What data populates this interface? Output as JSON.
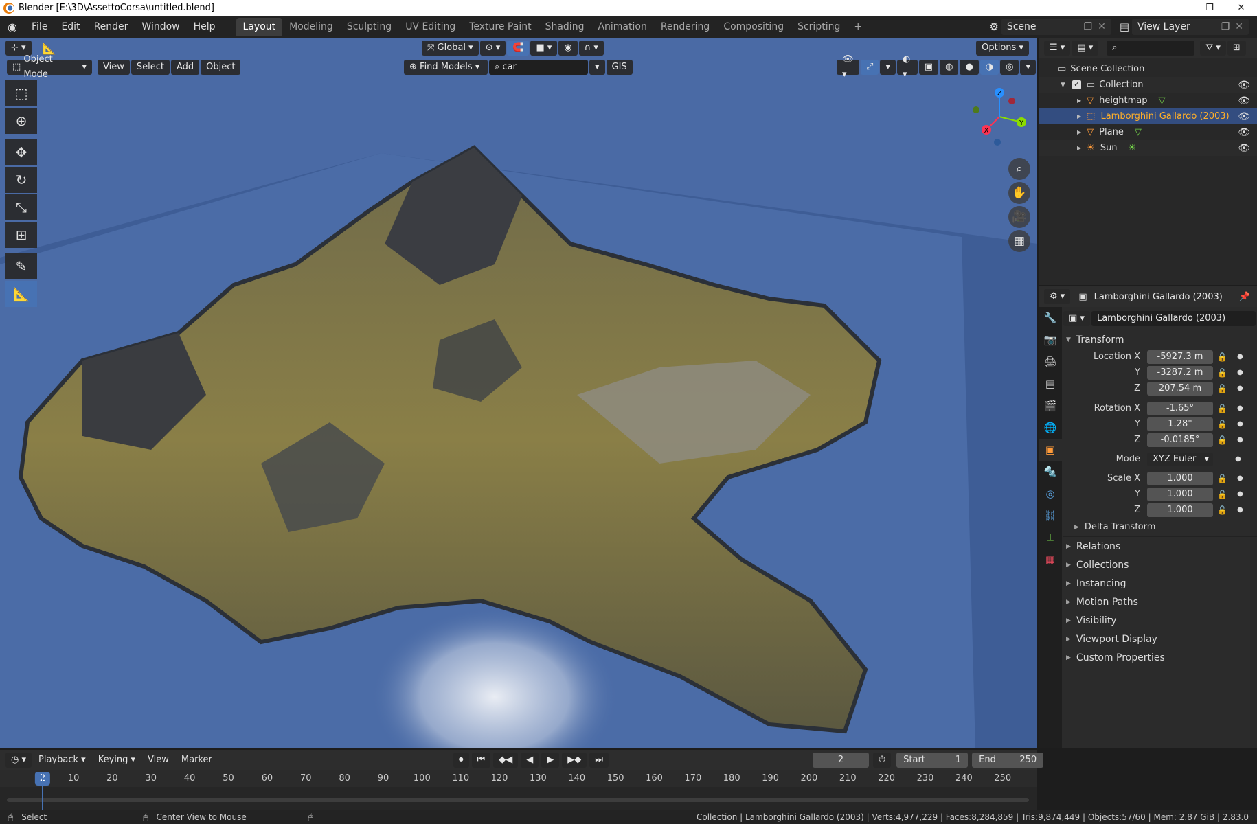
{
  "titlebar": {
    "title": "Blender [E:\\3D\\AssettoCorsa\\untitled.blend]",
    "minimize": "—",
    "restore": "❐",
    "close": "✕"
  },
  "menus": [
    "File",
    "Edit",
    "Render",
    "Window",
    "Help"
  ],
  "workspaces": [
    "Layout",
    "Modeling",
    "Sculpting",
    "UV Editing",
    "Texture Paint",
    "Shading",
    "Animation",
    "Rendering",
    "Compositing",
    "Scripting",
    "+"
  ],
  "scene": {
    "name": "Scene",
    "view_layer": "View Layer"
  },
  "viewport": {
    "orientation": "Global",
    "options": "Options",
    "mode": "Object Mode",
    "menus": [
      "View",
      "Select",
      "Add",
      "Object"
    ],
    "find_models": "Find Models",
    "search_value": "car",
    "gis": "GIS",
    "gizmo_axes": [
      "X",
      "Y",
      "Z"
    ]
  },
  "outliner": {
    "root": "Scene Collection",
    "collection": "Collection",
    "items": [
      {
        "label": "heightmap",
        "icon": "mesh-icon",
        "selected": false
      },
      {
        "label": "Lamborghini Gallardo (2003)",
        "icon": "empty-icon",
        "selected": true
      },
      {
        "label": "Plane",
        "icon": "mesh-icon",
        "selected": false
      },
      {
        "label": "Sun",
        "icon": "light-icon",
        "selected": false
      }
    ]
  },
  "properties": {
    "object_name": "Lamborghini Gallardo (2003)",
    "data_name": "Lamborghini Gallardo (2003)",
    "transform_label": "Transform",
    "location": {
      "label_x": "Location X",
      "x": "-5927.3 m",
      "y": "-3287.2 m",
      "z": "207.54 m"
    },
    "rotation": {
      "label_x": "Rotation X",
      "x": "-1.65°",
      "y": "1.28°",
      "z": "-0.0185°"
    },
    "mode": {
      "label": "Mode",
      "value": "XYZ Euler"
    },
    "scale": {
      "label_x": "Scale X",
      "x": "1.000",
      "y": "1.000",
      "z": "1.000"
    },
    "axis_y": "Y",
    "axis_z": "Z",
    "delta": "Delta Transform",
    "panels": [
      "Relations",
      "Collections",
      "Instancing",
      "Motion Paths",
      "Visibility",
      "Viewport Display",
      "Custom Properties"
    ]
  },
  "timeline": {
    "menus": [
      "Playback",
      "Keying",
      "View",
      "Marker"
    ],
    "current_frame": "2",
    "start_label": "Start",
    "start": "1",
    "end_label": "End",
    "end": "250",
    "ticks": [
      "2",
      "10",
      "20",
      "30",
      "40",
      "50",
      "60",
      "70",
      "80",
      "90",
      "100",
      "110",
      "120",
      "130",
      "140",
      "150",
      "160",
      "170",
      "180",
      "190",
      "200",
      "210",
      "220",
      "230",
      "240",
      "250"
    ]
  },
  "statusbar": {
    "left_action": "Select",
    "middle_action": "Center View to Mouse",
    "stats": "Collection | Lamborghini Gallardo (2003) | Verts:4,977,229 | Faces:8,284,859 | Tris:9,874,449 | Objects:57/60 | Mem: 2.87 GiB | 2.83.0"
  },
  "colors": {
    "accent": "#4772b3",
    "selected_text": "#ffaf29",
    "water": "#4a6aa5",
    "terrain": "#8a7d45"
  }
}
